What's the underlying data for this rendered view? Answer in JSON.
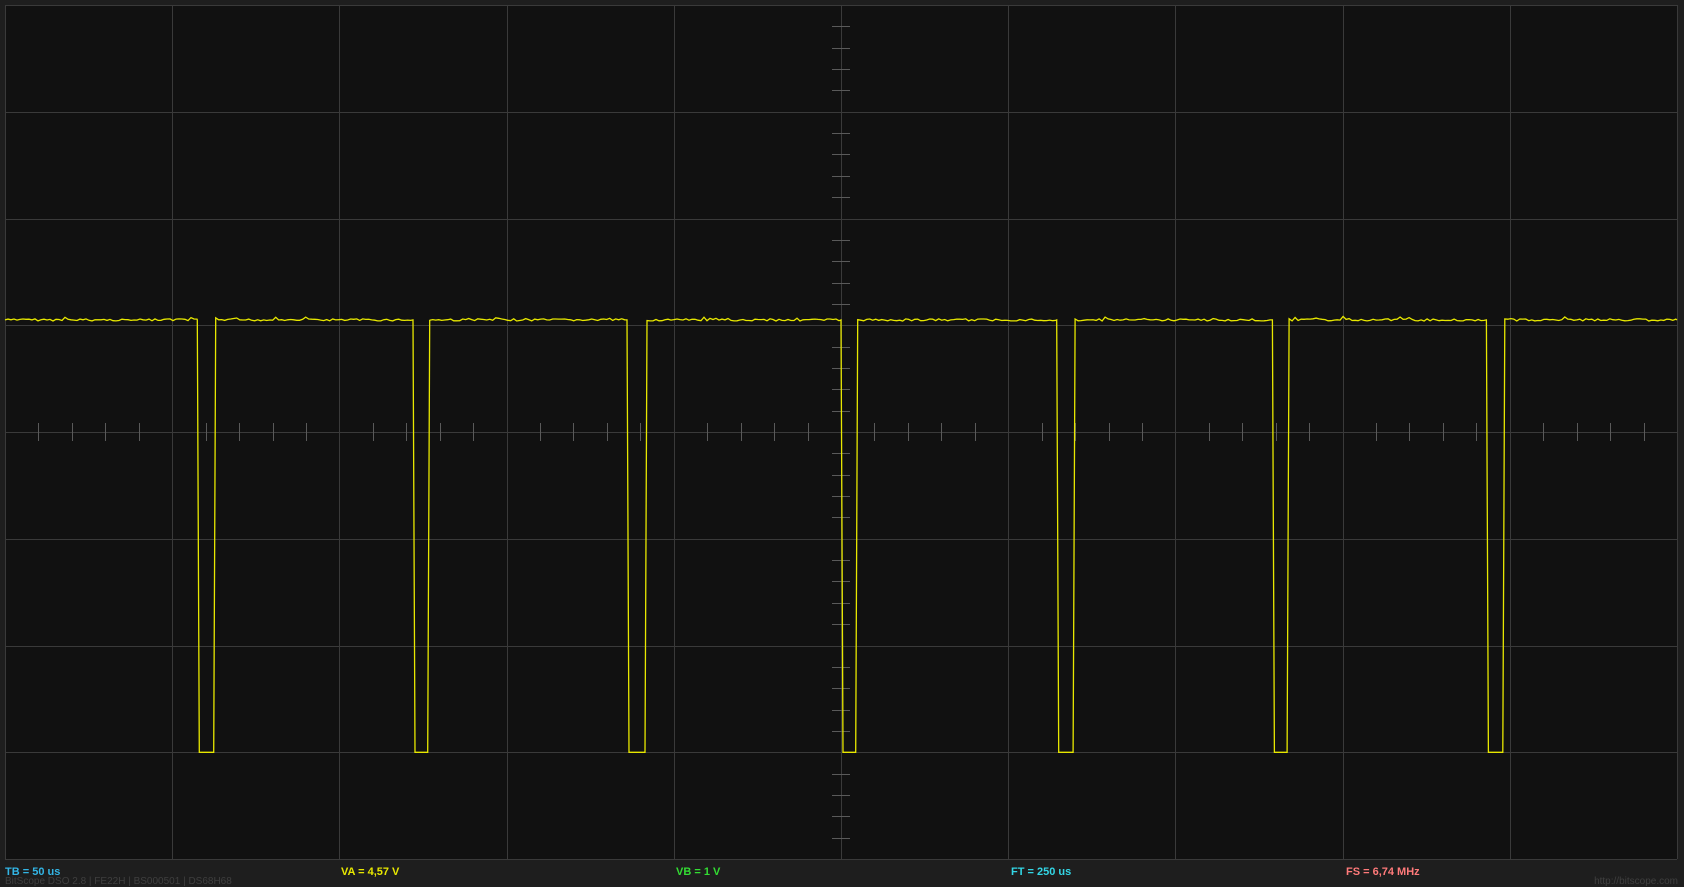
{
  "status_bar": {
    "readouts": [
      {
        "key": "tb",
        "text": "TB = 50 us",
        "color": "#33b5e5"
      },
      {
        "key": "va",
        "text": "VA = 4,57 V",
        "color": "#e8e800"
      },
      {
        "key": "vb",
        "text": "VB = 1 V",
        "color": "#33dd33"
      },
      {
        "key": "ft",
        "text": "FT = 250 us",
        "color": "#33d6e5"
      },
      {
        "key": "fs",
        "text": "FS = 6,74 MHz",
        "color": "#ff7a7a"
      }
    ],
    "footer_left": "BitScope DSO 2.8 | FE22H | BS000501 | DS68H68",
    "footer_right": "http://bitscope.com"
  },
  "display": {
    "grid_divisions_x": 10,
    "grid_divisions_y": 8,
    "background_color": "#111111",
    "grid_color": "#3a3a3a",
    "tick_color": "#5a5a5a",
    "trace_color": "#e8e800"
  },
  "chart_data": {
    "type": "line",
    "series": [
      {
        "name": "",
        "pulses": [
          {
            "fall_div": 1.15,
            "rise_div": 1.26
          },
          {
            "fall_div": 2.44,
            "rise_div": 2.54
          },
          {
            "fall_div": 3.72,
            "rise_div": 3.84
          },
          {
            "fall_div": 5.0,
            "rise_div": 5.1
          },
          {
            "fall_div": 6.29,
            "rise_div": 6.4
          },
          {
            "fall_div": 7.58,
            "rise_div": 7.68
          },
          {
            "fall_div": 8.86,
            "rise_div": 8.97
          }
        ],
        "high_level_div": 1.05,
        "low_level_div": -3.0
      }
    ],
    "xlim_div": [
      0,
      10
    ],
    "ylim_div": [
      -4,
      4
    ],
    "grid": true
  }
}
